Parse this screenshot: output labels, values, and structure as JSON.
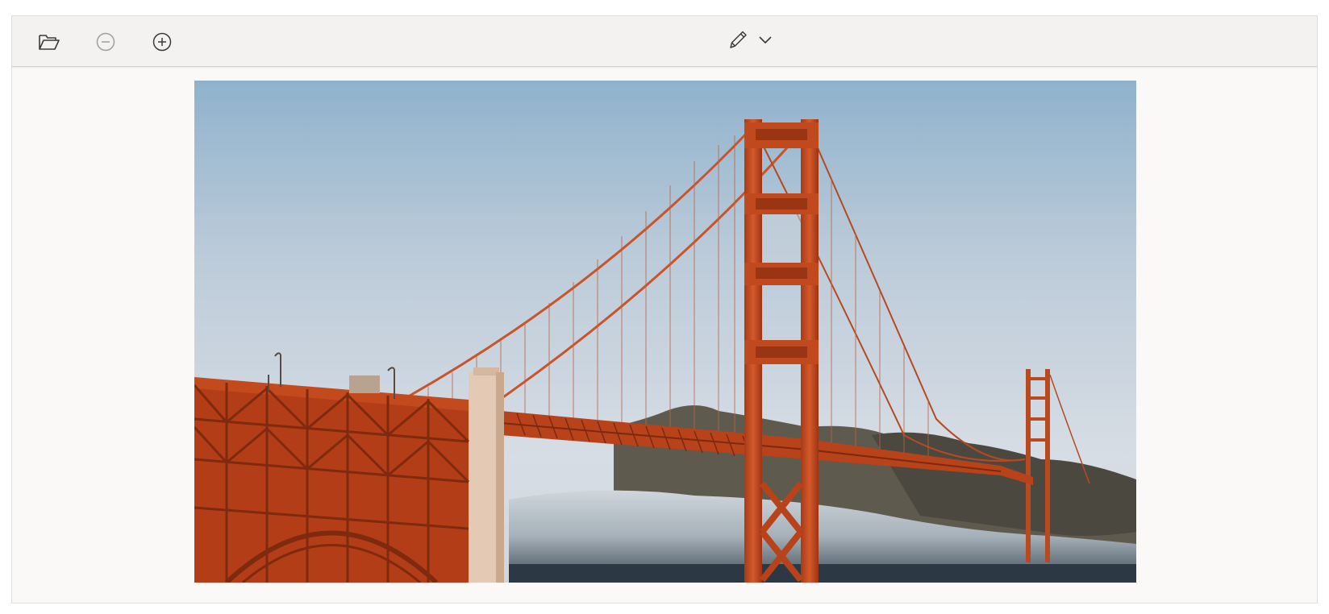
{
  "toolbar": {
    "open_icon": "folder-open-icon",
    "zoom_out_icon": "zoom-out-icon",
    "zoom_in_icon": "zoom-in-icon",
    "draw_icon": "pencil-icon",
    "draw_menu_icon": "chevron-down-icon",
    "zoom_out_enabled": false
  },
  "viewer": {
    "image_subject": "golden-gate-bridge-photo"
  },
  "colors": {
    "toolbar_bg": "#f3f2f1",
    "canvas_bg": "#faf9f8",
    "icon_color": "#3b3a39",
    "icon_disabled": "#a19f9d",
    "bridge_orange": "#c0441c",
    "sky_top": "#8fb2cc",
    "sky_bottom": "#d7dde4"
  }
}
